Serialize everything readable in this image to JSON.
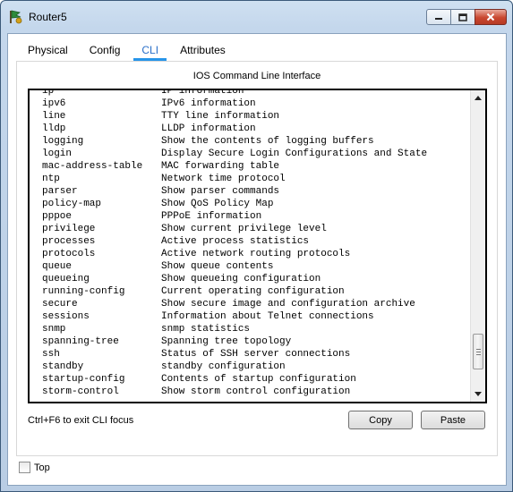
{
  "window": {
    "title": "Router5",
    "app_icon": "router-icon",
    "controls": [
      "minimize-icon",
      "maximize-icon",
      "close-icon"
    ]
  },
  "tabs": [
    {
      "label": "Physical",
      "active": false
    },
    {
      "label": "Config",
      "active": false
    },
    {
      "label": "CLI",
      "active": true
    },
    {
      "label": "Attributes",
      "active": false
    }
  ],
  "cli": {
    "title": "IOS Command Line Interface",
    "lines": [
      {
        "cmd": "ip",
        "desc": "IP information"
      },
      {
        "cmd": "ipv6",
        "desc": "IPv6 information"
      },
      {
        "cmd": "line",
        "desc": "TTY line information"
      },
      {
        "cmd": "lldp",
        "desc": "LLDP information"
      },
      {
        "cmd": "logging",
        "desc": "Show the contents of logging buffers"
      },
      {
        "cmd": "login",
        "desc": "Display Secure Login Configurations and State"
      },
      {
        "cmd": "mac-address-table",
        "desc": "MAC forwarding table"
      },
      {
        "cmd": "ntp",
        "desc": "Network time protocol"
      },
      {
        "cmd": "parser",
        "desc": "Show parser commands"
      },
      {
        "cmd": "policy-map",
        "desc": "Show QoS Policy Map"
      },
      {
        "cmd": "pppoe",
        "desc": "PPPoE information"
      },
      {
        "cmd": "privilege",
        "desc": "Show current privilege level"
      },
      {
        "cmd": "processes",
        "desc": "Active process statistics"
      },
      {
        "cmd": "protocols",
        "desc": "Active network routing protocols"
      },
      {
        "cmd": "queue",
        "desc": "Show queue contents"
      },
      {
        "cmd": "queueing",
        "desc": "Show queueing configuration"
      },
      {
        "cmd": "running-config",
        "desc": "Current operating configuration"
      },
      {
        "cmd": "secure",
        "desc": "Show secure image and configuration archive"
      },
      {
        "cmd": "sessions",
        "desc": "Information about Telnet connections"
      },
      {
        "cmd": "snmp",
        "desc": "snmp statistics"
      },
      {
        "cmd": "spanning-tree",
        "desc": "Spanning tree topology"
      },
      {
        "cmd": "ssh",
        "desc": "Status of SSH server connections"
      },
      {
        "cmd": "standby",
        "desc": "standby configuration"
      },
      {
        "cmd": "startup-config",
        "desc": "Contents of startup configuration"
      },
      {
        "cmd": "storm-control",
        "desc": "Show storm control configuration"
      }
    ],
    "hint": "Ctrl+F6 to exit CLI focus",
    "copy_label": "Copy",
    "paste_label": "Paste"
  },
  "footer": {
    "top_label": "Top",
    "top_checked": false
  }
}
